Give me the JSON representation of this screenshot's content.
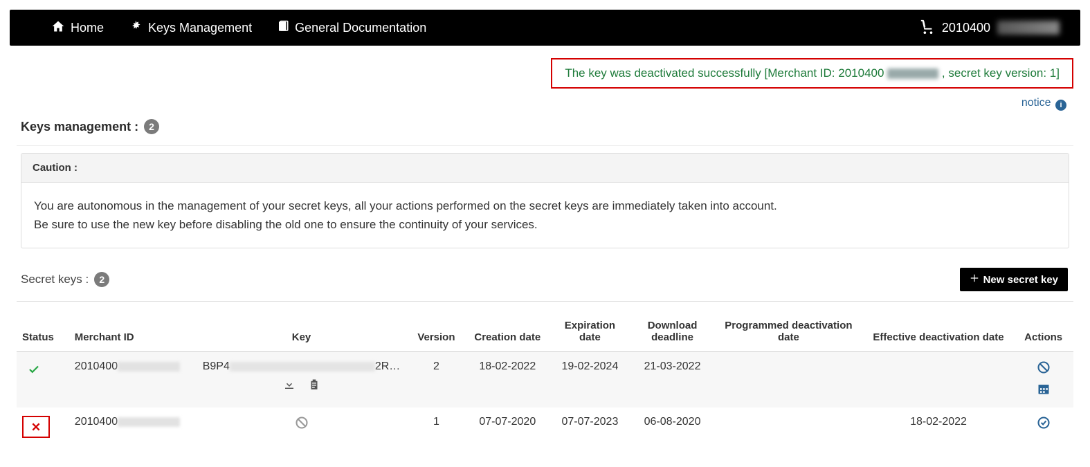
{
  "nav": {
    "home": "Home",
    "keys": "Keys Management",
    "docs": "General Documentation",
    "merchant_id": "2010400"
  },
  "success": {
    "prefix": "The key was deactivated successfully ",
    "bracket_open": "[Merchant ID: ",
    "merchant_id": "2010400",
    "suffix": ", secret key version: 1]"
  },
  "notice_label": "notice",
  "section": {
    "title": "Keys management :",
    "count": "2"
  },
  "caution": {
    "heading": "Caution :",
    "line1": "You are autonomous in the management of your secret keys, all your actions performed on the secret keys are immediately taken into account.",
    "line2": "Be sure to use the new key before disabling the old one to ensure the continuity of your services."
  },
  "secret_keys": {
    "title": "Secret keys :",
    "count": "2",
    "new_btn": "New secret key"
  },
  "columns": {
    "status": "Status",
    "merchant": "Merchant ID",
    "key": "Key",
    "version": "Version",
    "creation": "Creation date",
    "expiration": "Expiration date",
    "download": "Download deadline",
    "programmed": "Programmed deactivation date",
    "effective": "Effective deactivation date",
    "actions": "Actions"
  },
  "rows": [
    {
      "status": "active",
      "merchant_id": "2010400",
      "key_prefix": "B9P4",
      "key_suffix": "2R…",
      "version": "2",
      "creation": "18-02-2022",
      "expiration": "19-02-2024",
      "download": "21-03-2022",
      "programmed": "",
      "effective": ""
    },
    {
      "status": "deactivated",
      "merchant_id": "2010400",
      "key_prefix": "",
      "key_suffix": "",
      "version": "1",
      "creation": "07-07-2020",
      "expiration": "07-07-2023",
      "download": "06-08-2020",
      "programmed": "",
      "effective": "18-02-2022"
    }
  ]
}
